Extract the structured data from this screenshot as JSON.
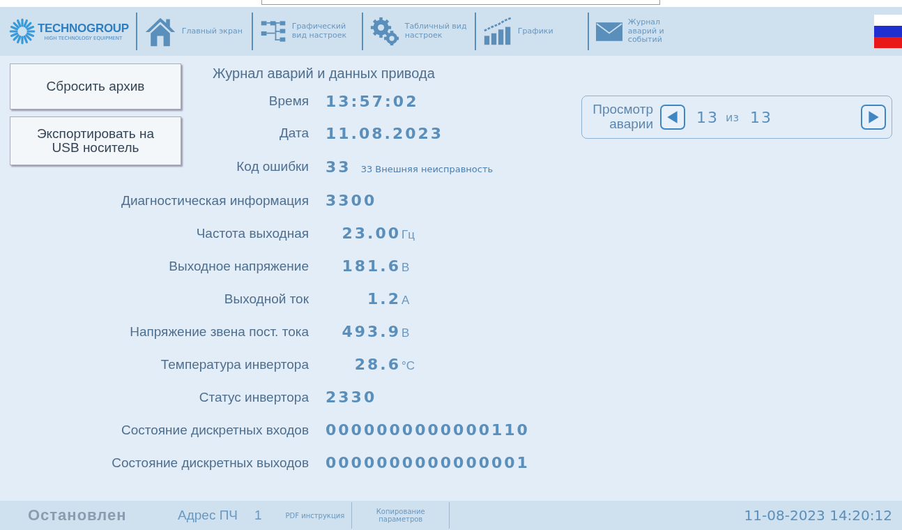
{
  "header": {
    "logo": "TECHNOGROUP",
    "logo_tagline": "HIGH TECHNOLOGY EQUIPMENT",
    "nav": [
      {
        "kind": "home",
        "label": "Главный экран"
      },
      {
        "kind": "tree",
        "label": "Графический вид настроек"
      },
      {
        "kind": "gears",
        "label": "Табличный вид настроек"
      },
      {
        "kind": "chart",
        "label": "Графики"
      },
      {
        "kind": "mail",
        "label": "Журнал аварий и событий"
      }
    ]
  },
  "buttons": [
    "Сбросить архив",
    "Экспортировать на USB носитель"
  ],
  "title": "Журнал аварий и данных привода",
  "viewer": {
    "label": "Просмотр аварии",
    "current": "13",
    "of": "из",
    "total": "13"
  },
  "rows": [
    {
      "label": "Время",
      "value": "13:57:02"
    },
    {
      "label": "Дата",
      "value": "11.08.2023"
    },
    {
      "label": "Код ошибки",
      "value": "33",
      "note": "33 Внешняя неисправность"
    },
    {
      "label": "Диагностическая информация",
      "value": "3300"
    },
    {
      "label": "Частота выходная",
      "value": "23.00",
      "unit": "Гц"
    },
    {
      "label": "Выходное напряжение",
      "value": "181.6",
      "unit": "В"
    },
    {
      "label": "Выходной ток",
      "value": "1.2",
      "unit": "А"
    },
    {
      "label": "Напряжение звена пост. тока",
      "value": "493.9",
      "unit": "В"
    },
    {
      "label": "Температура инвертора",
      "value": "28.6",
      "unit": "°C"
    },
    {
      "label": "Статус инвертора",
      "value": "2330"
    },
    {
      "label": "Состояние дискретных входов",
      "value": "0000000000000110"
    },
    {
      "label": "Состояние дискретных выходов",
      "value": "0000000000000001"
    }
  ],
  "status_bar": {
    "state": "Остановлен",
    "address_label": "Адрес ПЧ",
    "address": "1",
    "buttons": [
      "PDF инструкция",
      "Копирование параметров"
    ],
    "datetime": "11-08-2023 14:20:12"
  }
}
